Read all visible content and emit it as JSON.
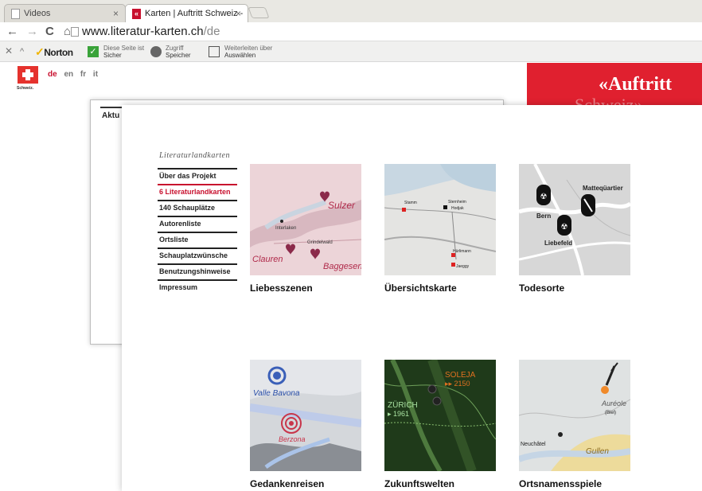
{
  "browser": {
    "tabs": [
      {
        "label": "Videos",
        "close": "×"
      },
      {
        "label": "Karten | Auftritt Schweiz -",
        "icon_text": "«",
        "close": "×"
      }
    ],
    "nav": {
      "back": "←",
      "forward": "→",
      "reload": "C",
      "home": "⌂"
    },
    "address": {
      "domain": "www.literatur-karten.ch",
      "path": "/de"
    }
  },
  "toolbar": {
    "close": "✕",
    "up": "^",
    "norton": "Norton",
    "safe_line1": "Diese Seite ist",
    "safe_line2": "Sicher",
    "vault_line1": "Zugriff",
    "vault_line2": "Speicher",
    "fwd_line1": "Weiterleiten über",
    "fwd_line2": "Auswählen"
  },
  "site": {
    "swiss_label": "Schweiz.",
    "langs": [
      "de",
      "en",
      "fr",
      "it"
    ],
    "brand": "«Auftritt",
    "brand2": "Schweiz»",
    "bg_label": "Aktu"
  },
  "sidebar": {
    "title": "Literaturlandkarten",
    "items": [
      "Über das Projekt",
      "6 Literaturlandkarten",
      "140 Schauplätze",
      "Autorenliste",
      "Ortsliste",
      "Schauplatzwünsche",
      "Benutzungshinweise",
      "Impressum"
    ]
  },
  "cards": [
    {
      "title": "Liebesszenen",
      "labels": [
        "Sulzer",
        "Interlaken",
        "Grindelwald",
        "Clauren",
        "Baggesen"
      ]
    },
    {
      "title": "Übersichtskarte",
      "labels": [
        "Stamm",
        "Sternheim",
        "Hodjak",
        "Hürlimann",
        "Jaeggy"
      ]
    },
    {
      "title": "Todesorte",
      "labels": [
        "Matteqüartier",
        "Bern",
        "Liebefeld"
      ]
    },
    {
      "title": "Gedankenreisen",
      "labels": [
        "Valle Bavona",
        "Berzona"
      ]
    },
    {
      "title": "Zukunftswelten",
      "labels": [
        "SOLEJA",
        "▸▸ 2150",
        "ZÜRICH",
        "▸ 1961"
      ]
    },
    {
      "title": "Ortsnamensspiele",
      "labels": [
        "Auréole",
        "(Biel)",
        "Neuchâtel",
        "Gullen"
      ]
    }
  ],
  "colors": {
    "accent": "#c8102e",
    "panel": "#e0202f"
  }
}
